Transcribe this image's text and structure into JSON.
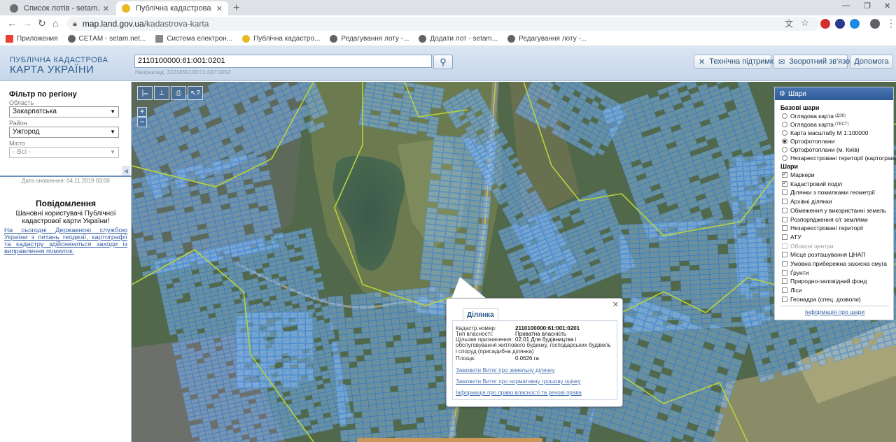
{
  "browser": {
    "tabs": [
      {
        "title": "Список лотів - setam.net.ua",
        "active": false,
        "favicon_color": "#6e6e6e"
      },
      {
        "title": "Публічна кадастрова карта Укр",
        "active": true,
        "favicon_color": "#e8b923"
      }
    ],
    "url_host": "map.land.gov.ua",
    "url_path": "/kadastrova-karta",
    "bookmarks": [
      {
        "label": "Приложения",
        "icon": "apps-grid-icon"
      },
      {
        "label": "СЕТАМ - setam.net...",
        "icon": "globe-icon"
      },
      {
        "label": "Система електрон...",
        "icon": "document-icon"
      },
      {
        "label": "Публічна кадастро...",
        "icon": "map-icon"
      },
      {
        "label": "Редагування лоту -...",
        "icon": "globe-icon"
      },
      {
        "label": "Додати лот - setam...",
        "icon": "globe-icon"
      },
      {
        "label": "Редагування лоту -...",
        "icon": "globe-icon"
      }
    ]
  },
  "header": {
    "logo_line1": "ПУБЛІЧНА КАДАСТРОВА",
    "logo_line2": "КАРТА УКРАЇНИ",
    "search_value": "2110100000:61:001:0201",
    "search_hint": "Наприклад: 3221655100:01:047:0052",
    "buttons": {
      "support": "Технічна підтримка",
      "feedback": "Зворотний зв'язок",
      "help": "Допомога"
    }
  },
  "filter": {
    "title": "Фільтр по регіону",
    "oblast_label": "Область",
    "oblast_value": "Закарпатська",
    "rayon_label": "Район",
    "rayon_value": "Ужгород",
    "city_label": "Місто",
    "city_value": "- Всі -",
    "updated": "Дата оновлення: 04.11.2019 03:00"
  },
  "notice": {
    "title": "Повідомлення",
    "greeting": "Шановні користувачі Публічної кадастрової карти України!",
    "link_text": "На сьогодні Державною службою України з питань геодезії, картографії та кадастру здійснюються заходи із виправлення помилок."
  },
  "popup": {
    "tab_label": "Ділянка",
    "rows": [
      {
        "label": "Кадастр.номер:",
        "value": "2110100000:61:001:0201",
        "bold": true
      },
      {
        "label": "Тип власності:",
        "value": "Приватна власність",
        "bold": false
      },
      {
        "label": "Цільове призначення:",
        "value": "02.01 Для будівництва і",
        "bold": false
      }
    ],
    "purpose_continued": "обслуговування житлового будинку, господарських будівель і споруд (присадибна ділянка)",
    "area_label": "Площа:",
    "area_value": "0.0626 га",
    "links": [
      "Замовити Витяг про земельну ділянку",
      "Замовити Витяг про нормативну грошову оцінку",
      "Інформація про право власності та речові права"
    ]
  },
  "layers": {
    "title": "Шари",
    "base_title": "Базові шари",
    "base": [
      {
        "label": "Оглядова карта",
        "sup": "(ДЗК)",
        "checked": false
      },
      {
        "label": "Оглядова карта",
        "sup": "(ТЕСТ)",
        "checked": false
      },
      {
        "label": "Карта масштабу М 1:100000",
        "sup": "",
        "checked": false
      },
      {
        "label": "Ортофотоплани",
        "sup": "",
        "checked": true
      },
      {
        "label": "Ортофотоплани (м. Київ)",
        "sup": "",
        "checked": false
      },
      {
        "label": "Незареєстровані території (картограма)",
        "sup": "",
        "checked": false
      }
    ],
    "overlay_title": "Шари",
    "overlays": [
      {
        "label": "Маркери",
        "checked": true,
        "disabled": false
      },
      {
        "label": "Кадастровий поділ",
        "checked": true,
        "disabled": false
      },
      {
        "label": "Ділянки з помилками геометрії",
        "checked": false,
        "disabled": false
      },
      {
        "label": "Архівні ділянки",
        "checked": false,
        "disabled": false
      },
      {
        "label": "Обмеження у використанні земель",
        "checked": false,
        "disabled": false
      },
      {
        "label": "Розпорядження с/г землями",
        "checked": false,
        "disabled": false
      },
      {
        "label": "Незареєстровані території",
        "checked": false,
        "disabled": false
      },
      {
        "label": "АТУ",
        "checked": false,
        "disabled": false
      },
      {
        "label": "Обласні центри",
        "checked": false,
        "disabled": true
      },
      {
        "label": "Місце розташування ЦНАП",
        "checked": false,
        "disabled": false
      },
      {
        "label": "Умовна прибережна захисна смуга",
        "checked": false,
        "disabled": false
      },
      {
        "label": "Ґрунти",
        "checked": false,
        "disabled": false
      },
      {
        "label": "Природно-заповідний фонд",
        "checked": false,
        "disabled": false
      },
      {
        "label": "Ліси",
        "checked": false,
        "disabled": false
      },
      {
        "label": "Геонадра (спец. дозволи)",
        "checked": false,
        "disabled": false
      }
    ],
    "info_link": "Інформація про шари"
  },
  "colors": {
    "parcel_fill": "#8fc1ff",
    "parcel_stroke": "#4a90e2",
    "boundary": "#b8d43c",
    "accent": "#2d5b8c"
  }
}
